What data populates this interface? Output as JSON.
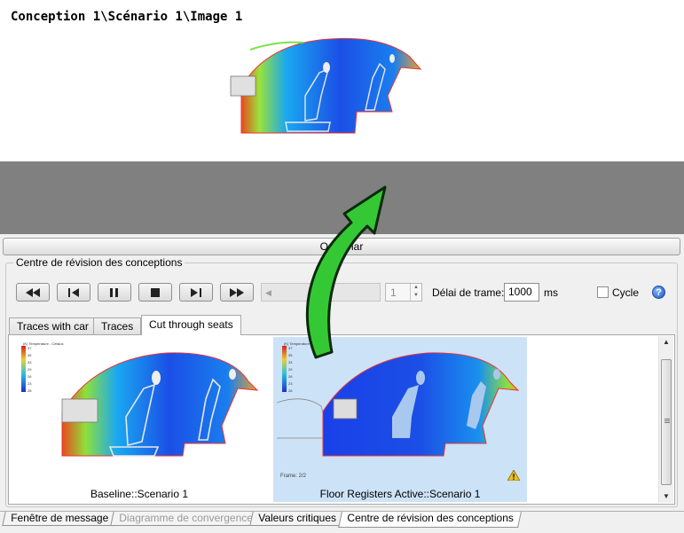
{
  "view": {
    "title": "Conception 1\\Scénario 1\\Image 1"
  },
  "toolbar": {
    "label": "Outil mar"
  },
  "review": {
    "group_title": "Centre de révision des conceptions",
    "frame_value": "1",
    "delay_label": "Délai de trame:",
    "delay_value": "1000",
    "delay_unit": "ms",
    "cycle_label": "Cycle",
    "cycle_checked": false,
    "help_glyph": "?",
    "buttons": [
      "rewind-icon",
      "step-back-icon",
      "pause-icon",
      "stop-icon",
      "step-forward-icon",
      "fast-forward-icon"
    ]
  },
  "tabs": [
    {
      "label": "Traces with car",
      "active": false
    },
    {
      "label": "Traces",
      "active": false
    },
    {
      "label": "Cut through seats",
      "active": true
    }
  ],
  "cards": [
    {
      "label": "Baseline::Scenario 1",
      "selected": false
    },
    {
      "label": "Floor Registers Active::Scenario 1",
      "selected": true,
      "frame": "Frame: 2/2",
      "warning": true
    }
  ],
  "legend": {
    "title": "(K) Temperature - Celsius",
    "ticks": [
      "37",
      "35",
      "33",
      "29",
      "26",
      "23",
      "28"
    ]
  },
  "bottom_tabs": [
    {
      "label": "Fenêtre de message",
      "state": "normal"
    },
    {
      "label": "Diagramme de convergence",
      "state": "disabled"
    },
    {
      "label": "Valeurs critiques",
      "state": "normal"
    },
    {
      "label": "Centre de révision des conceptions",
      "state": "active"
    }
  ],
  "colors": {
    "accent_arrow": "#2ecc2e",
    "selected_bg": "#cce2f7",
    "gray_view": "#808080"
  }
}
